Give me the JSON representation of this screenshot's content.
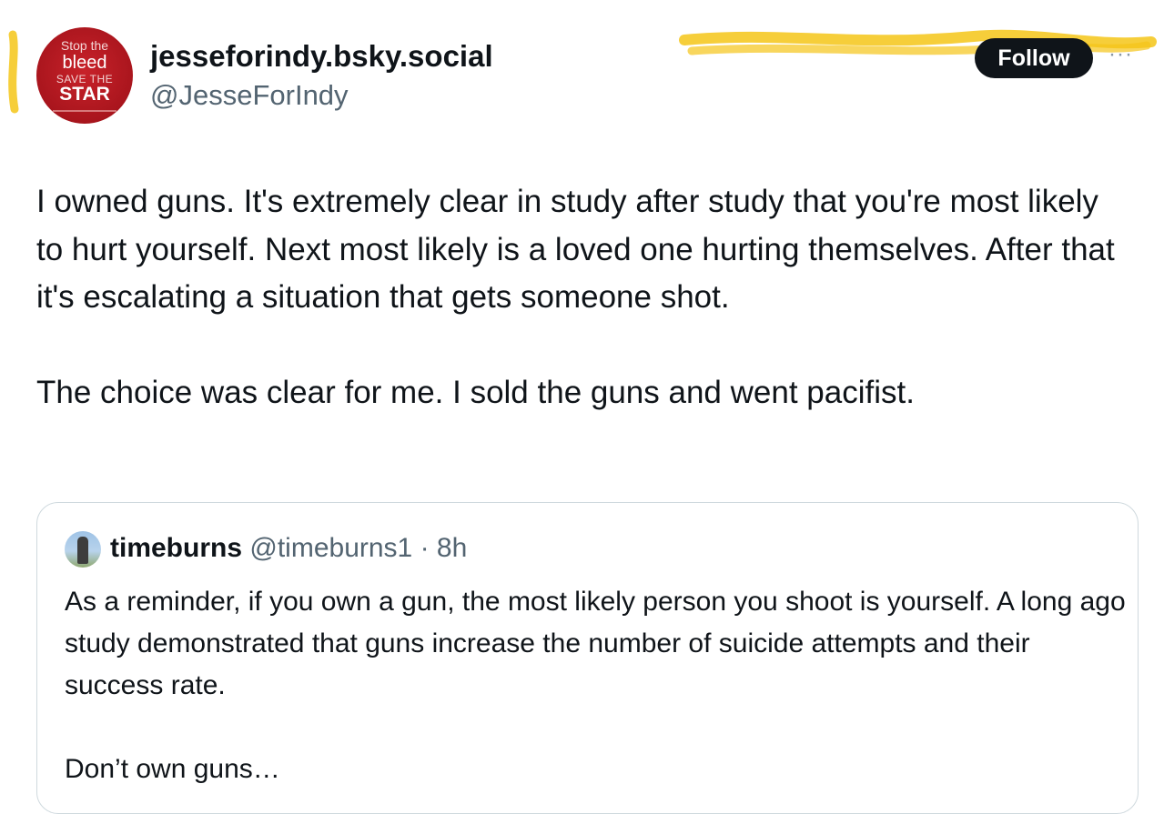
{
  "author": {
    "display_name": "jesseforindy.bsky.social",
    "handle": "@JesseForIndy",
    "avatar": {
      "line1": "Stop the",
      "line2": "bleed",
      "line3": "SAVE THE",
      "line4": "STAR"
    }
  },
  "follow_label": "Follow",
  "more_icon": "···",
  "post": {
    "paragraph1": "I owned guns. It's extremely clear in study after study that you're most likely to hurt yourself. Next most likely is a loved one hurting themselves. After that it's escalating a situation that gets someone shot.",
    "paragraph2": "The choice was clear for me. I sold the guns and went pacifist."
  },
  "quote": {
    "display_name": "timeburns",
    "handle": "@timeburns1",
    "separator": " · ",
    "time": "8h",
    "paragraph1": "As a reminder, if you own a gun, the most likely person you shoot is yourself. A long ago study demonstrated that guns increase the number of suicide attempts and their success rate.",
    "paragraph2": "Don’t own guns…"
  },
  "colors": {
    "highlighter": "#f5c518",
    "follow_bg": "#0f1419",
    "secondary_text": "#536471",
    "border": "#cfd9de"
  }
}
